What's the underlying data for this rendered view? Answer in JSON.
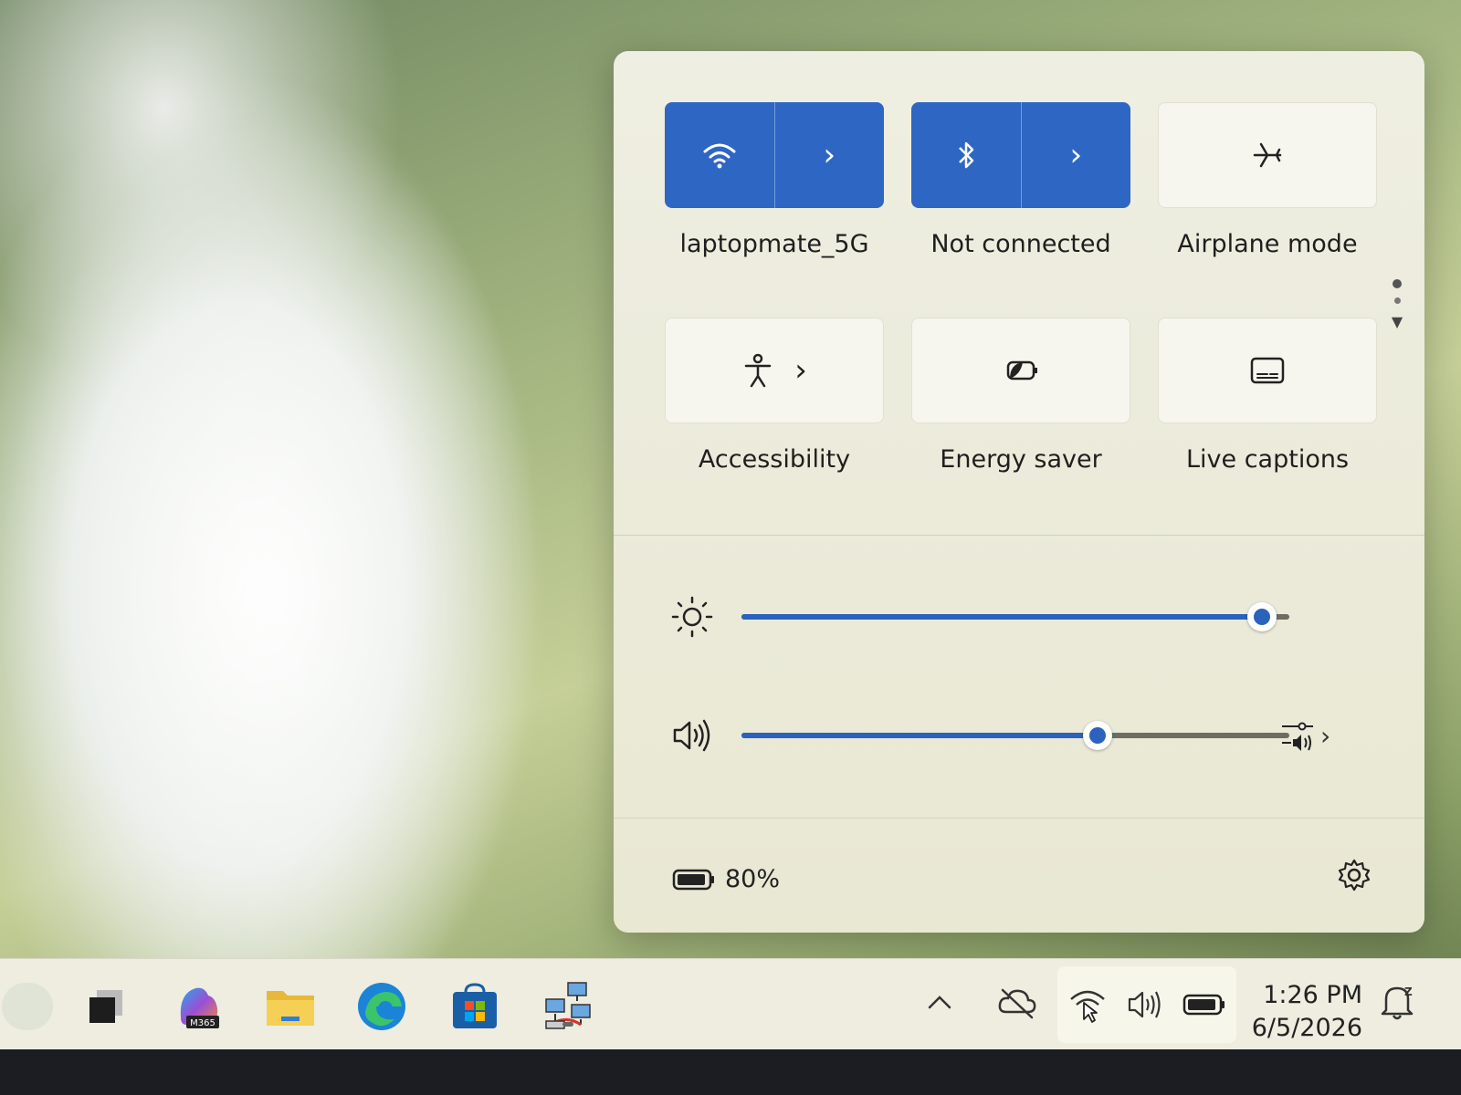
{
  "quick_settings": {
    "tiles": [
      {
        "id": "wifi",
        "label": "laptopmate_5G",
        "state": "on",
        "icon": "wifi-icon",
        "has_chevron": true
      },
      {
        "id": "bluetooth",
        "label": "Not connected",
        "state": "on",
        "icon": "bluetooth-icon",
        "has_chevron": true
      },
      {
        "id": "airplane",
        "label": "Airplane mode",
        "state": "off",
        "icon": "airplane-icon",
        "has_chevron": false
      },
      {
        "id": "accessibility",
        "label": "Accessibility",
        "state": "off",
        "icon": "accessibility-icon",
        "has_chevron": true
      },
      {
        "id": "energy",
        "label": "Energy saver",
        "state": "off",
        "icon": "energy-saver-icon",
        "has_chevron": false
      },
      {
        "id": "captions",
        "label": "Live captions",
        "state": "off",
        "icon": "live-captions-icon",
        "has_chevron": false
      }
    ],
    "brightness": {
      "icon": "brightness-icon",
      "level": 0.95
    },
    "volume": {
      "icon": "speaker-icon",
      "level": 0.65,
      "output_icon": "audio-output-icon"
    },
    "battery": {
      "percent": "80%",
      "icon": "battery-icon"
    },
    "settings_icon": "gear-icon"
  },
  "taskbar": {
    "apps": [
      {
        "name": "copilot-app",
        "icon": "copilot-icon"
      },
      {
        "name": "file-explorer",
        "icon": "folder-icon"
      },
      {
        "name": "edge-browser",
        "icon": "edge-icon"
      },
      {
        "name": "microsoft-store",
        "icon": "store-icon"
      },
      {
        "name": "network-app",
        "icon": "network-computers-icon"
      }
    ],
    "m365_badge": "M365",
    "clock": {
      "time": "1:26 PM",
      "date": "6/5/2026"
    },
    "notification_badge": "Z"
  },
  "colors": {
    "accent": "#2e66c4",
    "panel": "#eeeee2",
    "taskbar": "#eeede0"
  }
}
